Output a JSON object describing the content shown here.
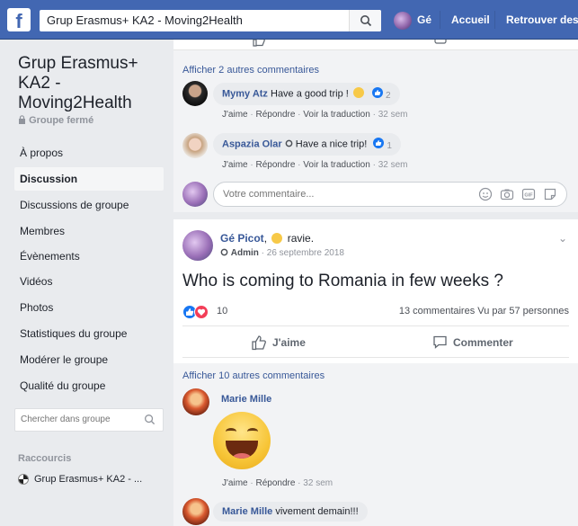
{
  "topbar": {
    "logo": "f",
    "search_value": "Grup Erasmus+ KA2 - Moving2Health",
    "user_name": "Gé",
    "nav_home": "Accueil",
    "nav_find_friends": "Retrouver des a"
  },
  "sidebar": {
    "group_title": "Grup Erasmus+ KA2 - Moving2Health",
    "group_type": "Groupe fermé",
    "items": [
      {
        "label": "À propos"
      },
      {
        "label": "Discussion"
      },
      {
        "label": "Discussions de groupe"
      },
      {
        "label": "Membres"
      },
      {
        "label": "Évènements"
      },
      {
        "label": "Vidéos"
      },
      {
        "label": "Photos"
      },
      {
        "label": "Statistiques du groupe"
      },
      {
        "label": "Modérer le groupe"
      },
      {
        "label": "Qualité du groupe"
      }
    ],
    "search_placeholder": "Chercher dans groupe",
    "shortcuts_title": "Raccourcis",
    "shortcut_label": "Grup Erasmus+ KA2 - ..."
  },
  "post1": {
    "more_comments": "Afficher 2 autres commentaires",
    "comments": [
      {
        "name": "Mymy Atz",
        "text": "Have a good trip !",
        "reaction_count": "2",
        "actions": [
          "J'aime",
          "Répondre",
          "Voir la traduction"
        ],
        "time": "32 sem"
      },
      {
        "name": "Aspazia Olar",
        "text": "Have a nice trip!",
        "reaction_count": "1",
        "actions": [
          "J'aime",
          "Répondre",
          "Voir la traduction"
        ],
        "time": "32 sem"
      }
    ],
    "comment_placeholder": "Votre commentaire..."
  },
  "post2": {
    "author": "Gé Picot",
    "feeling": "ravie.",
    "role": "Admin",
    "date": "26 septembre 2018",
    "text": "Who is coming to Romania in few weeks ?",
    "reaction_count": "10",
    "comments_count": "13 commentaires",
    "seen_by": "Vu par 57 personnes",
    "like_label": "J'aime",
    "comment_label": "Commenter",
    "more_comments": "Afficher 10 autres commentaires",
    "comments": [
      {
        "name": "Marie Mille",
        "actions": [
          "J'aime",
          "Répondre"
        ],
        "time": "32 sem"
      },
      {
        "name": "Marie Mille",
        "text": "vivement demain!!!"
      }
    ]
  },
  "colors": {
    "brand": "#4267b2",
    "link": "#385898",
    "background": "#e9ebee"
  }
}
